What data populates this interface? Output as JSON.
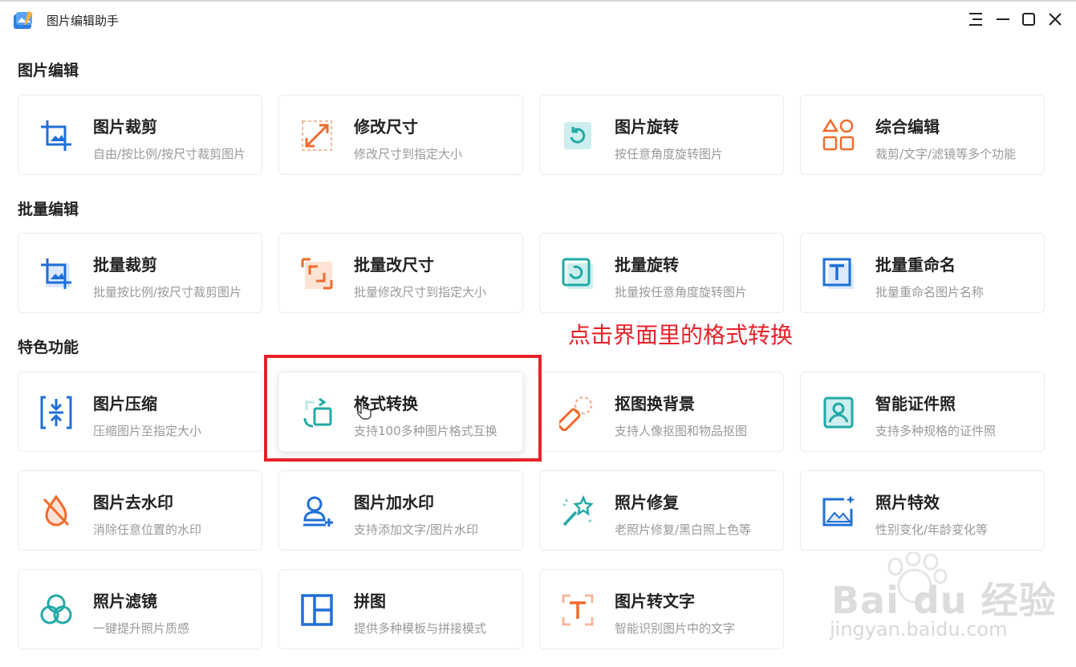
{
  "app": {
    "title": "图片编辑助手"
  },
  "sections": [
    {
      "title": "图片编辑",
      "cards": [
        {
          "title": "图片裁剪",
          "desc": "自由/按比例/按尺寸裁剪图片",
          "icon": "crop-icon"
        },
        {
          "title": "修改尺寸",
          "desc": "修改尺寸到指定大小",
          "icon": "resize-icon"
        },
        {
          "title": "图片旋转",
          "desc": "按任意角度旋转图片",
          "icon": "rotate-icon"
        },
        {
          "title": "综合编辑",
          "desc": "裁剪/文字/滤镜等多个功能",
          "icon": "shapes-icon"
        }
      ]
    },
    {
      "title": "批量编辑",
      "cards": [
        {
          "title": "批量裁剪",
          "desc": "批量按比例/按尺寸裁剪图片",
          "icon": "batch-crop-icon"
        },
        {
          "title": "批量改尺寸",
          "desc": "批量修改尺寸到指定大小",
          "icon": "batch-resize-icon"
        },
        {
          "title": "批量旋转",
          "desc": "批量按任意角度旋转图片",
          "icon": "batch-rotate-icon"
        },
        {
          "title": "批量重命名",
          "desc": "批量重命名图片名称",
          "icon": "batch-rename-icon"
        }
      ]
    },
    {
      "title": "特色功能",
      "cards": [
        {
          "title": "图片压缩",
          "desc": "压缩图片至指定大小",
          "icon": "compress-icon"
        },
        {
          "title": "格式转换",
          "desc": "支持100多种图片格式互换",
          "icon": "format-convert-icon"
        },
        {
          "title": "抠图换背景",
          "desc": "支持人像抠图和物品抠图",
          "icon": "cutout-icon"
        },
        {
          "title": "智能证件照",
          "desc": "支持多种规格的证件照",
          "icon": "id-photo-icon"
        },
        {
          "title": "图片去水印",
          "desc": "消除任意位置的水印",
          "icon": "remove-watermark-icon"
        },
        {
          "title": "图片加水印",
          "desc": "支持添加文字/图片水印",
          "icon": "add-watermark-icon"
        },
        {
          "title": "照片修复",
          "desc": "老照片修复/黑白照上色等",
          "icon": "magic-wand-icon"
        },
        {
          "title": "照片特效",
          "desc": "性别变化/年龄变化等",
          "icon": "photo-effect-icon"
        },
        {
          "title": "照片滤镜",
          "desc": "一键提升照片质感",
          "icon": "filter-icon"
        },
        {
          "title": "拼图",
          "desc": "提供多种模板与拼接模式",
          "icon": "collage-icon"
        },
        {
          "title": "图片转文字",
          "desc": "智能识别图片中的文字",
          "icon": "ocr-icon"
        }
      ]
    }
  ],
  "annotation": {
    "text": "点击界面里的格式转换",
    "color": "#e8212a"
  },
  "watermark": {
    "brand": "Bai du 经验",
    "url": "jingyan.baidu.com"
  },
  "colors": {
    "blue": "#1f6fd6",
    "orange": "#f06b2c",
    "teal": "#21a9a6",
    "highlight": "#e8212a"
  }
}
